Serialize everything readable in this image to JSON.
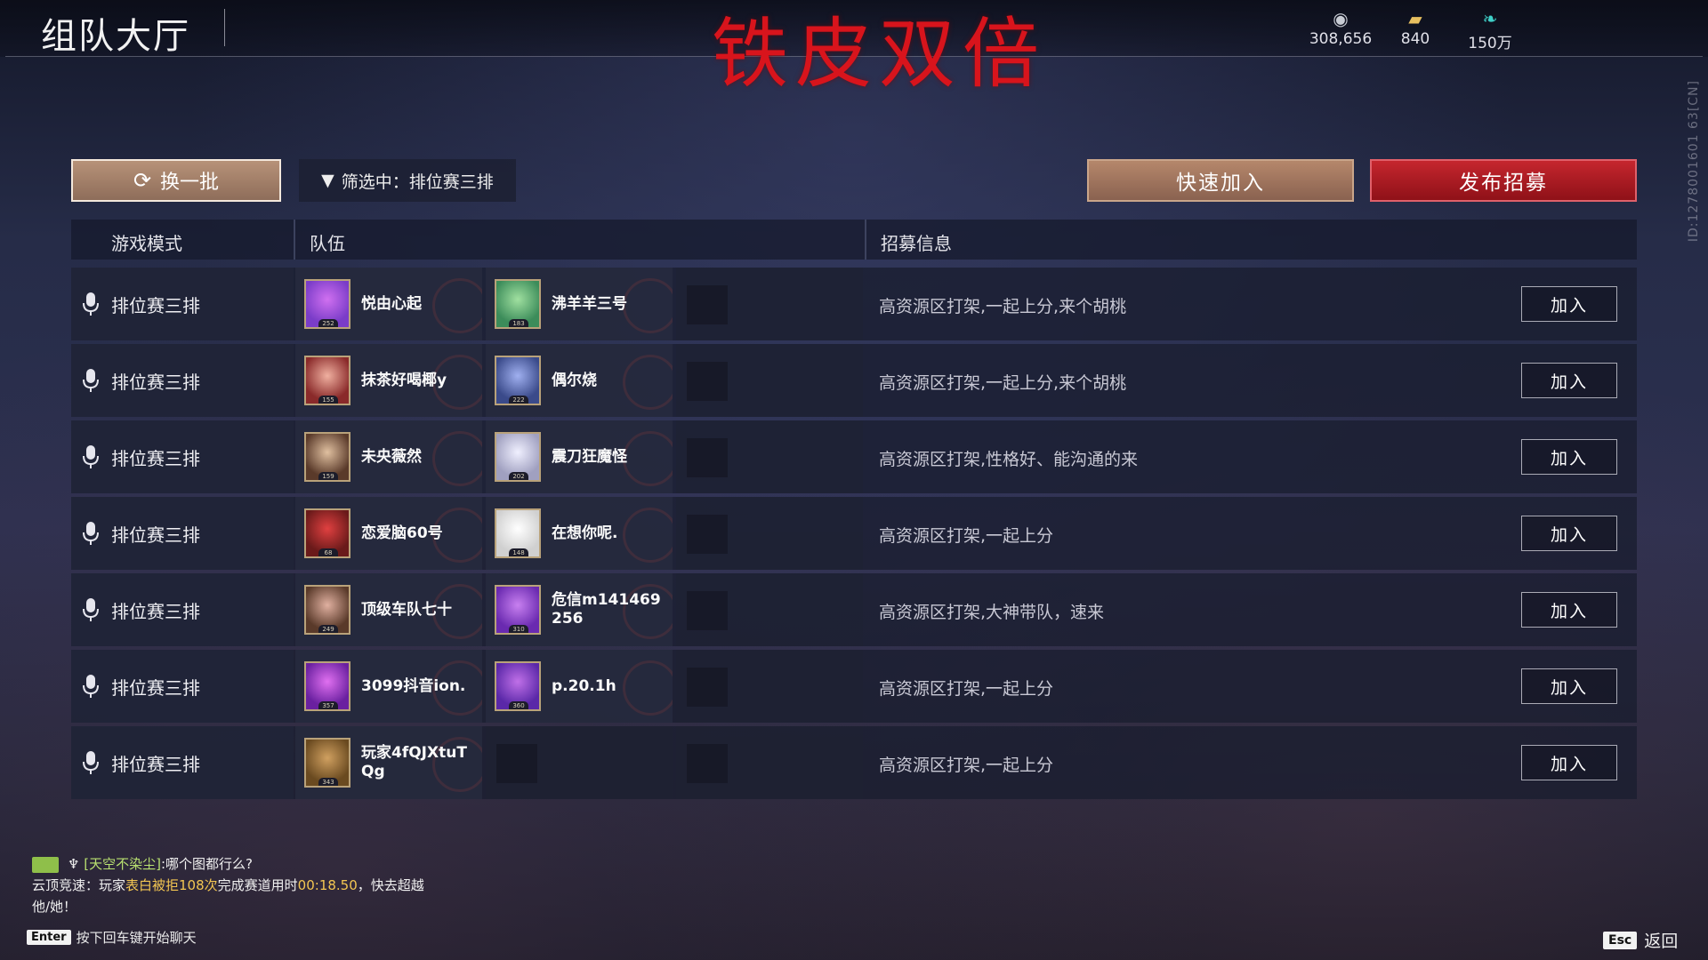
{
  "header": {
    "title": "组队大厅",
    "watermark": "铁皮双倍",
    "currencies": [
      {
        "icon": "coin-icon",
        "value": "308,656"
      },
      {
        "icon": "gold-ticket-icon",
        "value": "840"
      },
      {
        "icon": "feather-icon",
        "value": "150万"
      }
    ],
    "side_id": "ID:1278001601 63[CN]"
  },
  "toolbar": {
    "refresh_label": "换一批",
    "filter_label": "筛选中：排位赛三排",
    "quick_join_label": "快速加入",
    "post_recruit_label": "发布招募"
  },
  "table": {
    "headers": [
      "游戏模式",
      "队伍",
      "招募信息"
    ],
    "join_label": "加入",
    "rows": [
      {
        "mode": "排位赛三排",
        "p1": {
          "name": "悦由心起",
          "lvl": "252"
        },
        "p2": {
          "name": "沸羊羊三号",
          "lvl": "183"
        },
        "info": "高资源区打架,一起上分,来个胡桃"
      },
      {
        "mode": "排位赛三排",
        "p1": {
          "name": "抹茶好喝椰y",
          "lvl": "155"
        },
        "p2": {
          "name": "偶尔烧",
          "lvl": "222"
        },
        "info": "高资源区打架,一起上分,来个胡桃"
      },
      {
        "mode": "排位赛三排",
        "p1": {
          "name": "未央薇然",
          "lvl": "159"
        },
        "p2": {
          "name": "震刀狂魔怪",
          "lvl": "202"
        },
        "info": "高资源区打架,性格好、能沟通的来"
      },
      {
        "mode": "排位赛三排",
        "p1": {
          "name": "恋爱脑60号",
          "lvl": "68"
        },
        "p2": {
          "name": "在想你呢.",
          "lvl": "148"
        },
        "info": "高资源区打架,一起上分"
      },
      {
        "mode": "排位赛三排",
        "p1": {
          "name": "顶级车队七十",
          "lvl": "249"
        },
        "p2": {
          "name": "危信m141469256",
          "lvl": "310"
        },
        "info": "高资源区打架,大神带队，速来"
      },
      {
        "mode": "排位赛三排",
        "p1": {
          "name": "3099抖音ion.",
          "lvl": "357"
        },
        "p2": {
          "name": "p.20.1h",
          "lvl": "360"
        },
        "info": "高资源区打架,一起上分"
      },
      {
        "mode": "排位赛三排",
        "p1": {
          "name": "玩家4fQJXtuTQg",
          "lvl": "343"
        },
        "p2": null,
        "info": "高资源区打架,一起上分"
      }
    ]
  },
  "chat": {
    "line1_user": "[天空不染尘]",
    "line1_msg": ":哪个图都行么?",
    "line2_a": "云顶竞速：玩家",
    "line2_hl": "表白被拒108次",
    "line2_b": "完成赛道用时",
    "line2_time": "00:18.50",
    "line2_c": "，快去超越他/她！"
  },
  "footer": {
    "enter_key": "Enter",
    "enter_hint": "按下回车键开始聊天",
    "esc_key": "Esc",
    "esc_label": "返回"
  },
  "colors": {
    "accent_red": "#c5262e",
    "accent_tan": "#b5876b",
    "highlight_gold": "#f3c652",
    "highlight_green": "#b8e070"
  }
}
